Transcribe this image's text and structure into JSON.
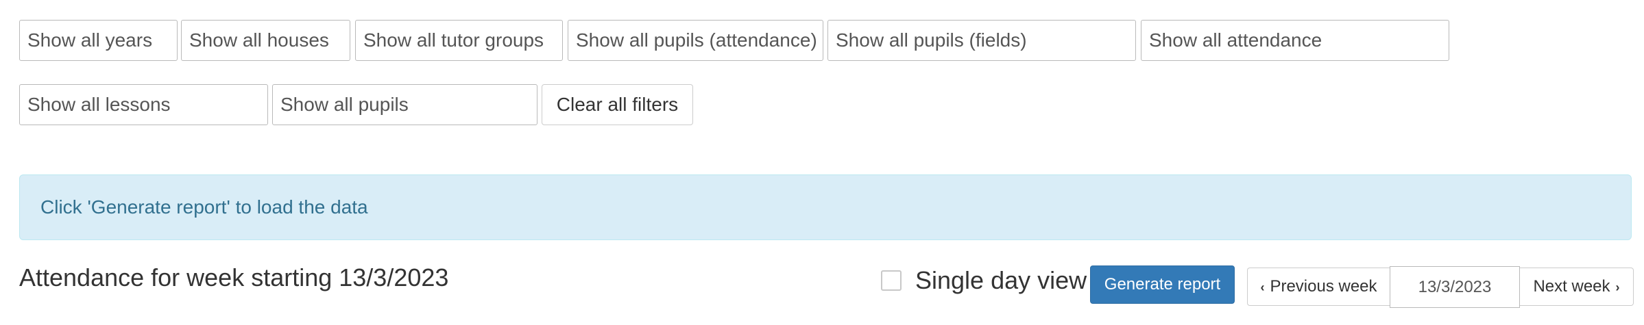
{
  "filters": {
    "years": "Show all years",
    "houses": "Show all houses",
    "tutor_groups": "Show all tutor groups",
    "pupils_attendance": "Show all pupils (attendance)",
    "pupils_fields": "Show all pupils (fields)",
    "attendance": "Show all attendance",
    "lessons": "Show all lessons",
    "pupils": "Show all pupils",
    "clear_label": "Clear all filters"
  },
  "alert": {
    "message": "Click 'Generate report' to load the data"
  },
  "report": {
    "heading": "Attendance for week starting 13/3/2023",
    "single_day_label": "Single day view",
    "single_day_checked": false,
    "generate_label": "Generate report",
    "prev_week_label": "Previous week",
    "next_week_label": "Next week",
    "week_value": "13/3/2023"
  },
  "icons": {
    "prev": "chevron-left-icon",
    "next": "chevron-right-icon"
  },
  "colors": {
    "primary": "#337ab7",
    "alert_bg": "#d9edf7",
    "alert_text": "#31708f"
  }
}
